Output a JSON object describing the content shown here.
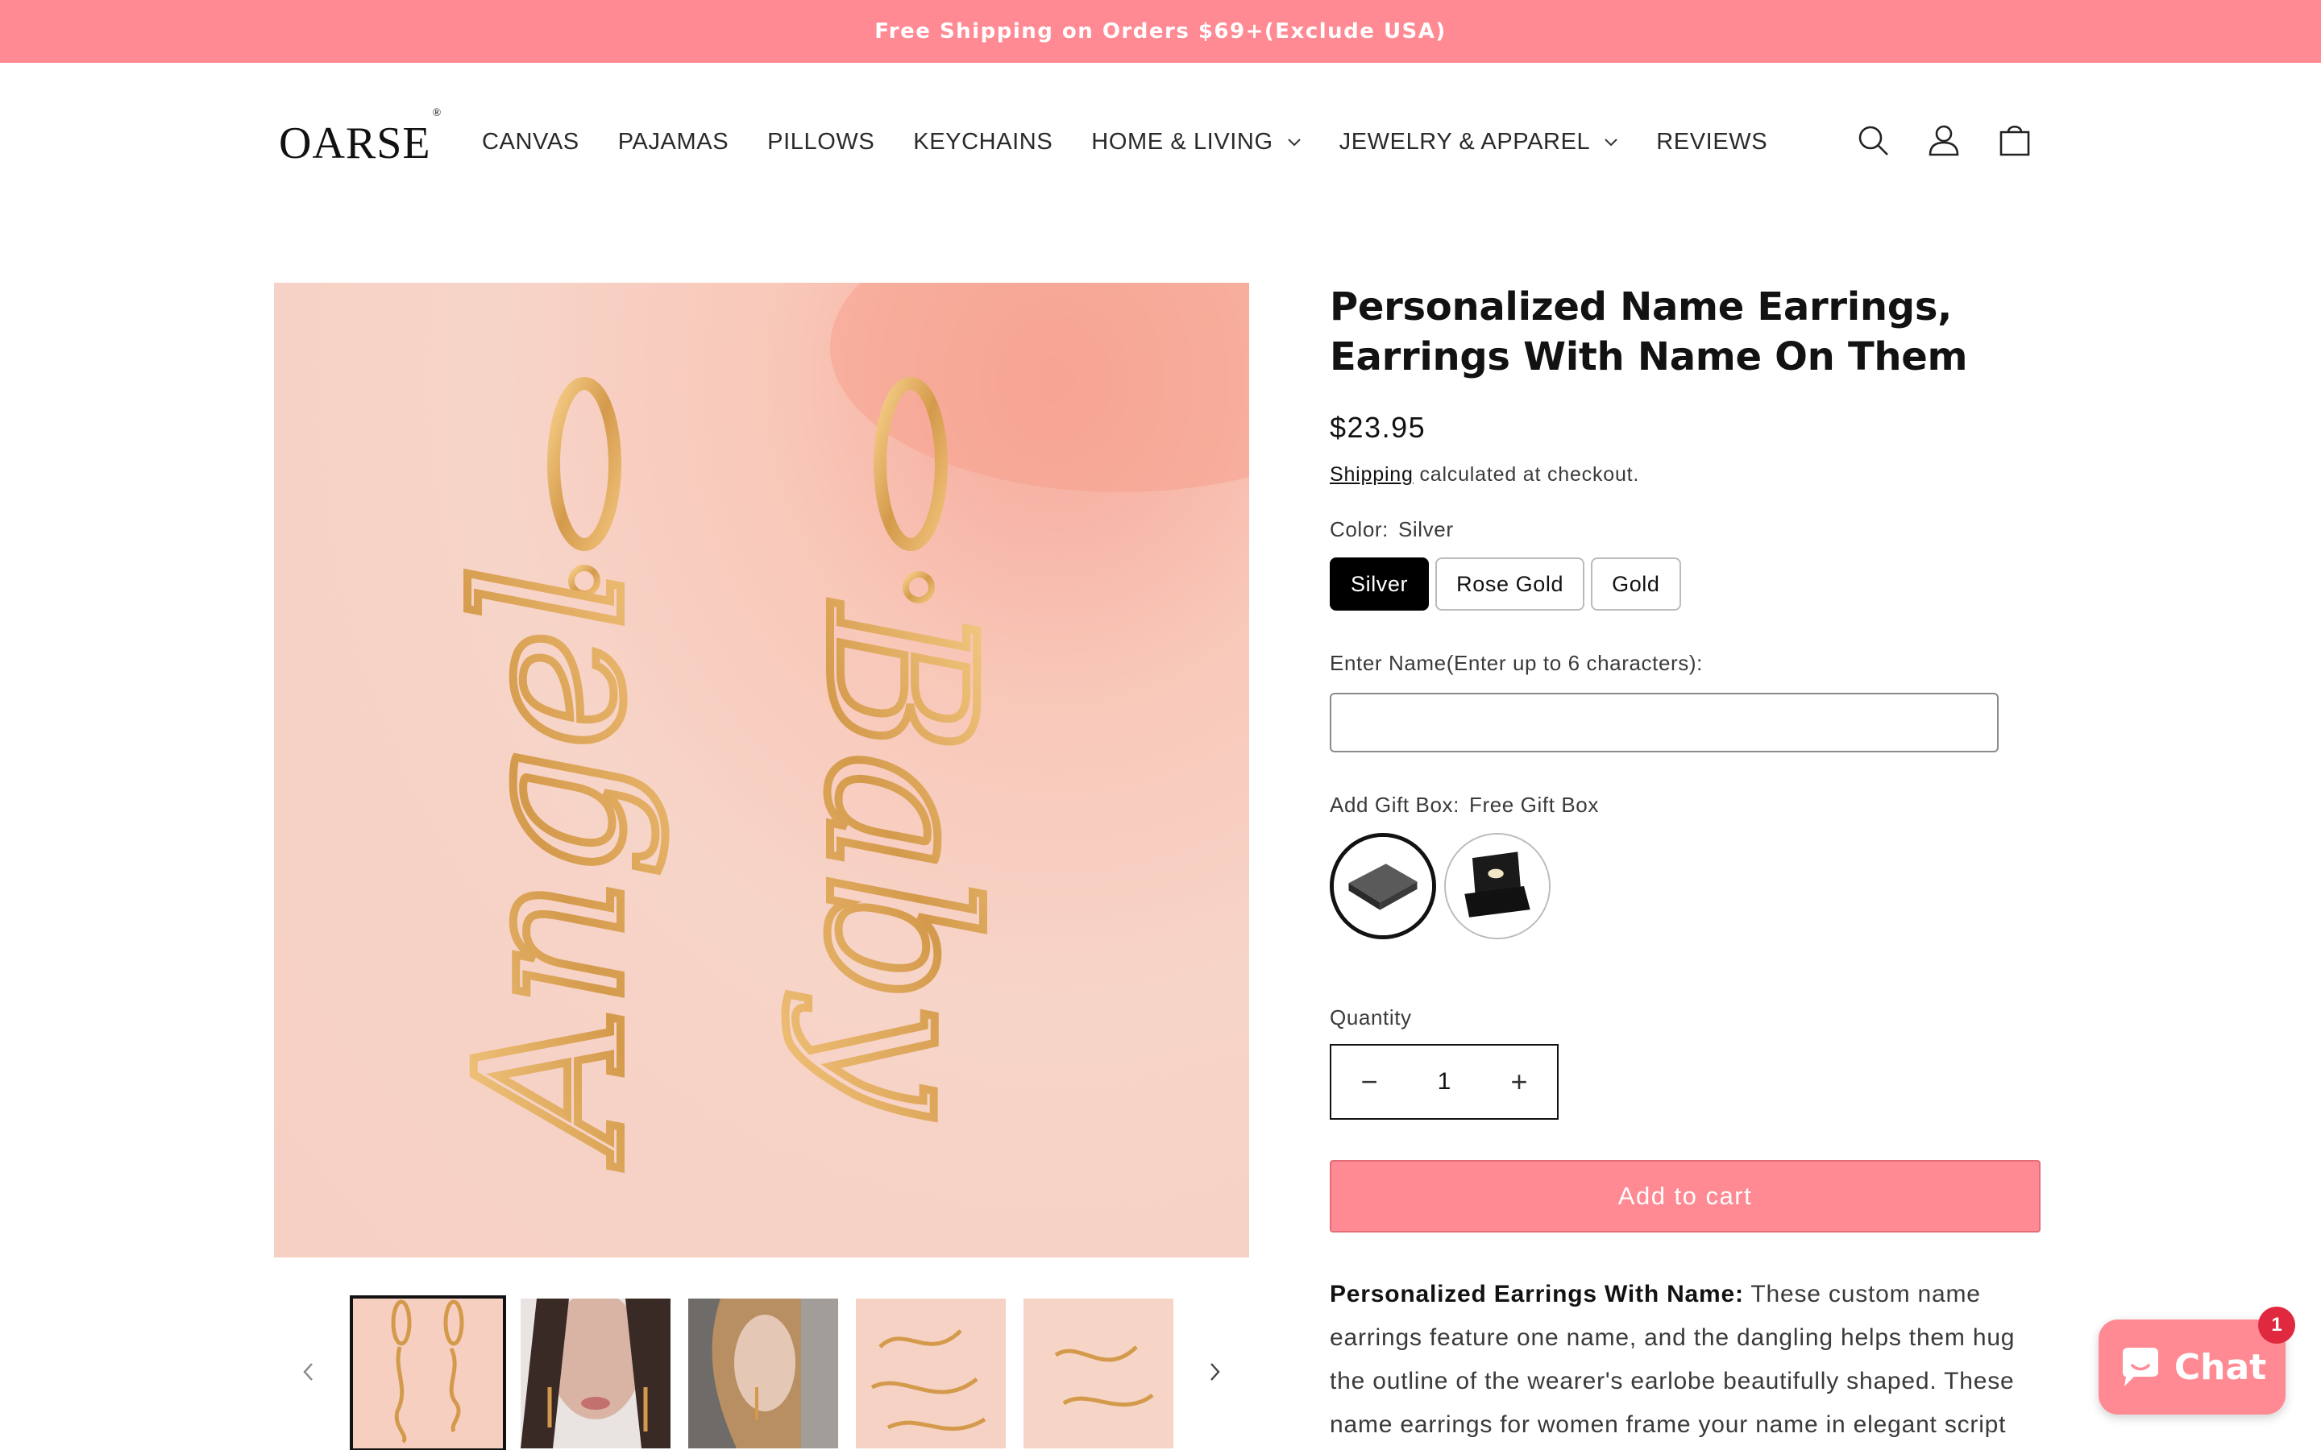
{
  "announcement": {
    "text": "Free Shipping on Orders $69+(Exclude USA)"
  },
  "header": {
    "logo": "OARSE",
    "logo_mark": "®",
    "nav": [
      {
        "label": "CANVAS",
        "dropdown": false
      },
      {
        "label": "PAJAMAS",
        "dropdown": false
      },
      {
        "label": "PILLOWS",
        "dropdown": false
      },
      {
        "label": "KEYCHAINS",
        "dropdown": false
      },
      {
        "label": "HOME & LIVING",
        "dropdown": true
      },
      {
        "label": "JEWELRY & APPAREL",
        "dropdown": true
      },
      {
        "label": "REVIEWS",
        "dropdown": false
      }
    ],
    "icons": [
      "search-icon",
      "account-icon",
      "cart-icon"
    ]
  },
  "gallery": {
    "main_image": {
      "words": [
        "Angel",
        "Baby"
      ]
    },
    "thumbnails_count": 5,
    "active_thumbnail": 1
  },
  "product": {
    "title": "Personalized Name Earrings, Earrings With Name On Them",
    "price": "$23.95",
    "shipping_link": "Shipping",
    "shipping_suffix": " calculated at checkout.",
    "color_label": "Color:",
    "color_value": "Silver",
    "colors": [
      "Silver",
      "Rose Gold",
      "Gold"
    ],
    "selected_color": "Silver",
    "name_label": "Enter Name(Enter up to 6 characters):",
    "name_value": "",
    "gift_label": "Add Gift Box:",
    "gift_value": "Free Gift Box",
    "quantity_label": "Quantity",
    "quantity": "1",
    "minus": "−",
    "plus": "+",
    "add_to_cart": "Add to cart",
    "desc_bold": "Personalized Earrings With Name:",
    "desc_text": " These custom name earrings feature one name, and the dangling helps them hug the outline of the wearer's earlobe beautifully shaped. These name earrings for women frame your name in elegant script"
  },
  "chat": {
    "label": "Chat",
    "badge": "1"
  },
  "colors": {
    "accent": "#ff8a93",
    "badge": "#e0293f",
    "text": "#121212"
  }
}
